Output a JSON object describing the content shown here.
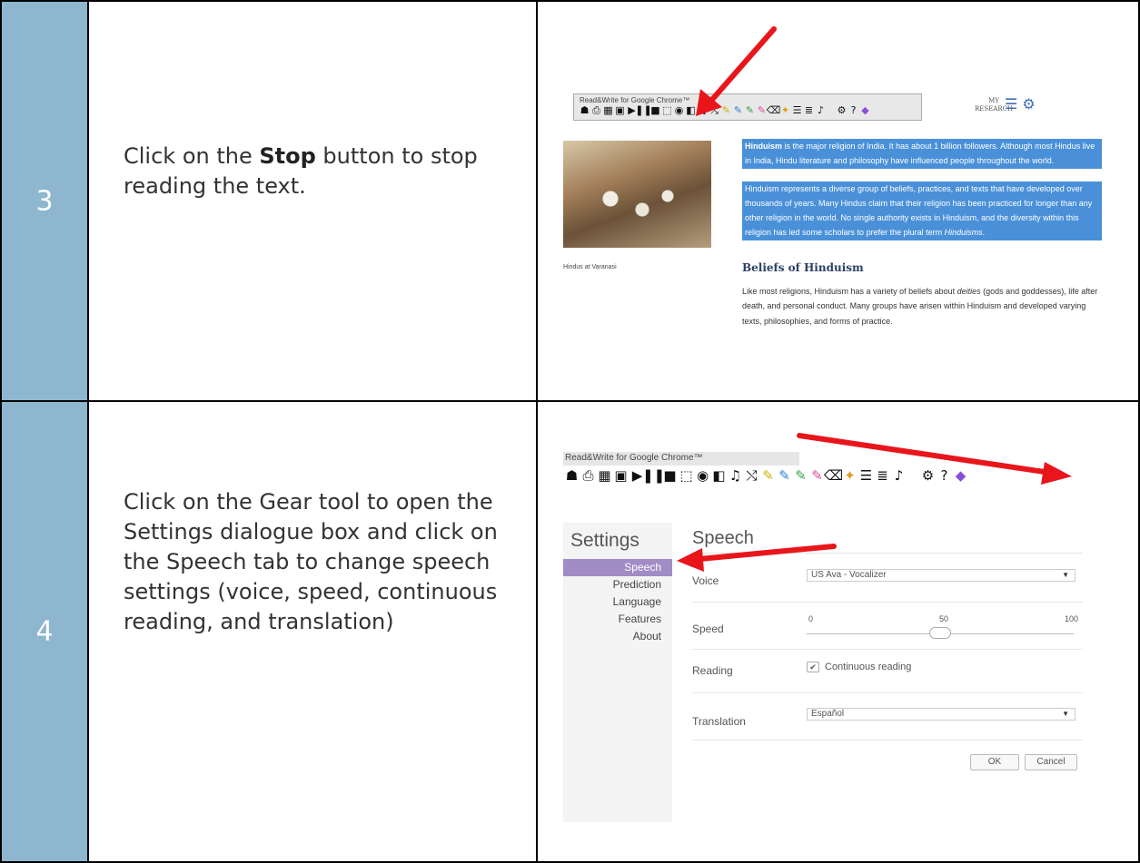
{
  "rows": [
    {
      "number": "3",
      "instruction_before": "Click on the ",
      "instruction_bold": "Stop",
      "instruction_after": " button to stop reading the text."
    },
    {
      "number": "4",
      "instruction": "Click on the Gear tool to open the Settings dialogue box and click on the Speech tab to change speech settings (voice, speed, continuous reading, and translation)"
    }
  ],
  "toolbar": {
    "title": "Read&Write for Google Chrome™",
    "icons": [
      "speaker-icon",
      "dictionary-icon",
      "picture-dictionary-icon",
      "screenshot-reader-icon",
      "play-icon",
      "pause-icon",
      "stop-icon",
      "screen-mask-icon",
      "talk-and-type-icon",
      "translator-icon",
      "audio-maker-icon",
      "web-search-icon",
      "highlighter-yellow-icon",
      "highlighter-blue-icon",
      "highlighter-green-icon",
      "highlighter-pink-icon",
      "clear-highlights-icon",
      "collect-highlights-icon",
      "vocabulary-list-icon",
      "simplify-page-icon",
      "voice-note-icon",
      "settings-gear-icon",
      "help-icon",
      "premium-icon"
    ]
  },
  "screenshot3": {
    "my_research": "MY\nRESEARCH",
    "photo_caption": "Hindus at Varanasi",
    "para1_bold": "Hinduism",
    "para1": " is the major religion of India. It has about 1 billion followers. Although most Hindus live in India, Hindu literature and philosophy have influenced people throughout the world.",
    "para2_a": "Hinduism represents a diverse group of beliefs, practices, and texts that have developed over thousands of years. Many Hindus claim that their religion has been practiced for longer than any other religion in the world. No single authority exists in Hinduism, and the diversity within this religion has led some scholars to prefer the plural term ",
    "para2_italic": "Hinduisms",
    "para2_b": ".",
    "heading": "Beliefs of Hinduism",
    "body_a": "Like most religions, Hinduism has a variety of beliefs about ",
    "body_italic": "deities",
    "body_b": " (gods and goddesses), life after death, and personal conduct. Many groups have arisen within Hinduism and developed varying texts, philosophies, and forms of practice."
  },
  "settings": {
    "title": "Settings",
    "tabs": [
      "Speech",
      "Prediction",
      "Language",
      "Features",
      "About"
    ],
    "active_tab": "Speech",
    "panel_title": "Speech",
    "voice_label": "Voice",
    "voice_value": "US Ava - Vocalizer",
    "speed_label": "Speed",
    "speed_ticks": [
      "0",
      "50",
      "100"
    ],
    "speed_value": 50,
    "reading_label": "Reading",
    "continuous_label": "Continuous reading",
    "continuous_checked": true,
    "translation_label": "Translation",
    "translation_value": "Español",
    "ok_label": "OK",
    "cancel_label": "Cancel"
  },
  "colors": {
    "number_cell": "#8eb6cf",
    "highlight": "#4a90d9",
    "active_tab": "#a28cc6",
    "arrow": "#e8161b"
  }
}
